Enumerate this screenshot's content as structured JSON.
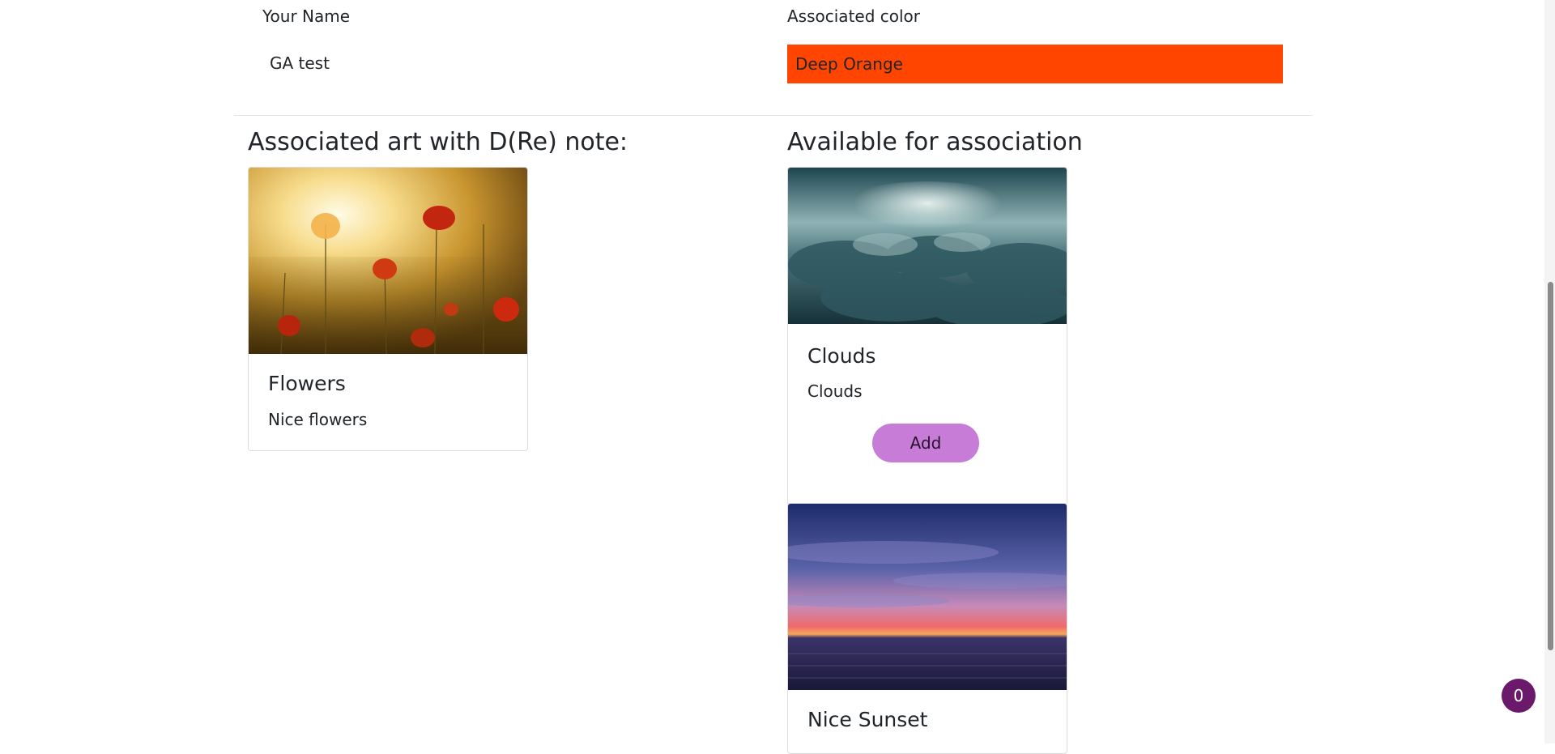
{
  "info": {
    "name_label": "Your Name",
    "name_value": "GA test",
    "color_label": "Associated color",
    "color_value": "Deep Orange",
    "color_hex": "#ff4500"
  },
  "associated": {
    "title": "Associated art with D(Re) note:",
    "cards": [
      {
        "title": "Flowers",
        "text": "Nice flowers",
        "image": "poppy-field-photo"
      }
    ]
  },
  "available": {
    "title": "Available for association",
    "cards": [
      {
        "title": "Clouds",
        "text": "Clouds",
        "button": "Add",
        "image": "cloud-sky-photo"
      },
      {
        "title": "Nice Sunset",
        "image": "sunset-sea-photo"
      }
    ]
  },
  "badge": {
    "count": "0"
  },
  "colors": {
    "accent_button": "#c77dd8",
    "badge": "#6b1a6b"
  }
}
